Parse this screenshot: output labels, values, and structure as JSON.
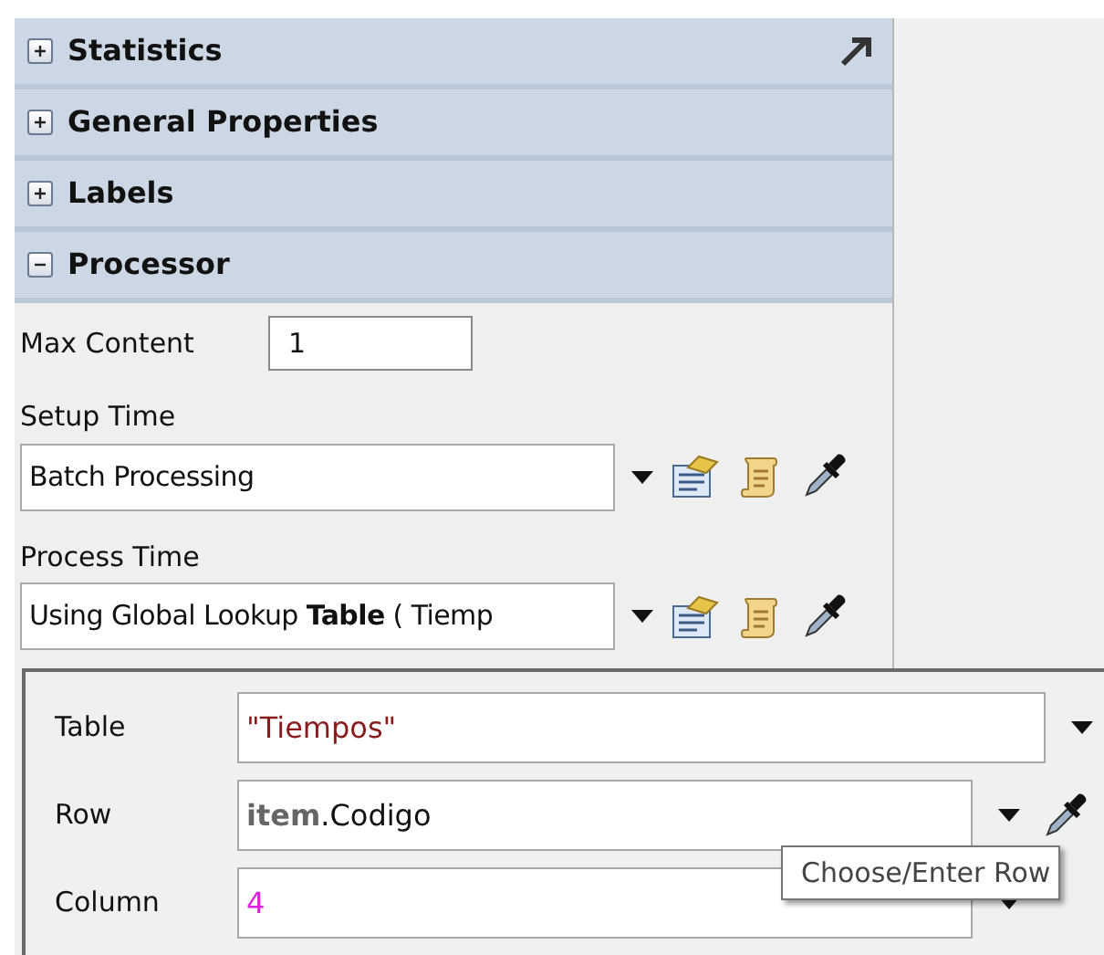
{
  "sections": [
    {
      "title": "Statistics",
      "expanded": false
    },
    {
      "title": "General Properties",
      "expanded": false
    },
    {
      "title": "Labels",
      "expanded": false
    },
    {
      "title": "Processor",
      "expanded": true
    }
  ],
  "processor": {
    "max_content": {
      "label": "Max Content",
      "value": "1"
    },
    "setup_time": {
      "label": "Setup Time",
      "value": "Batch Processing"
    },
    "process_time": {
      "label": "Process Time",
      "value": "Using Global Lookup **Table** ( Tiemp"
    }
  },
  "popup": {
    "fields": [
      {
        "label": "Table",
        "value": "\"Tiempos\"",
        "kind": "string",
        "picker": false
      },
      {
        "label": "Row",
        "value": "**item**.Codigo",
        "kind": "expression",
        "picker": true
      },
      {
        "label": "Column",
        "value": "4",
        "kind": "number",
        "picker": false
      }
    ],
    "tooltip": "Choose/Enter Row"
  }
}
